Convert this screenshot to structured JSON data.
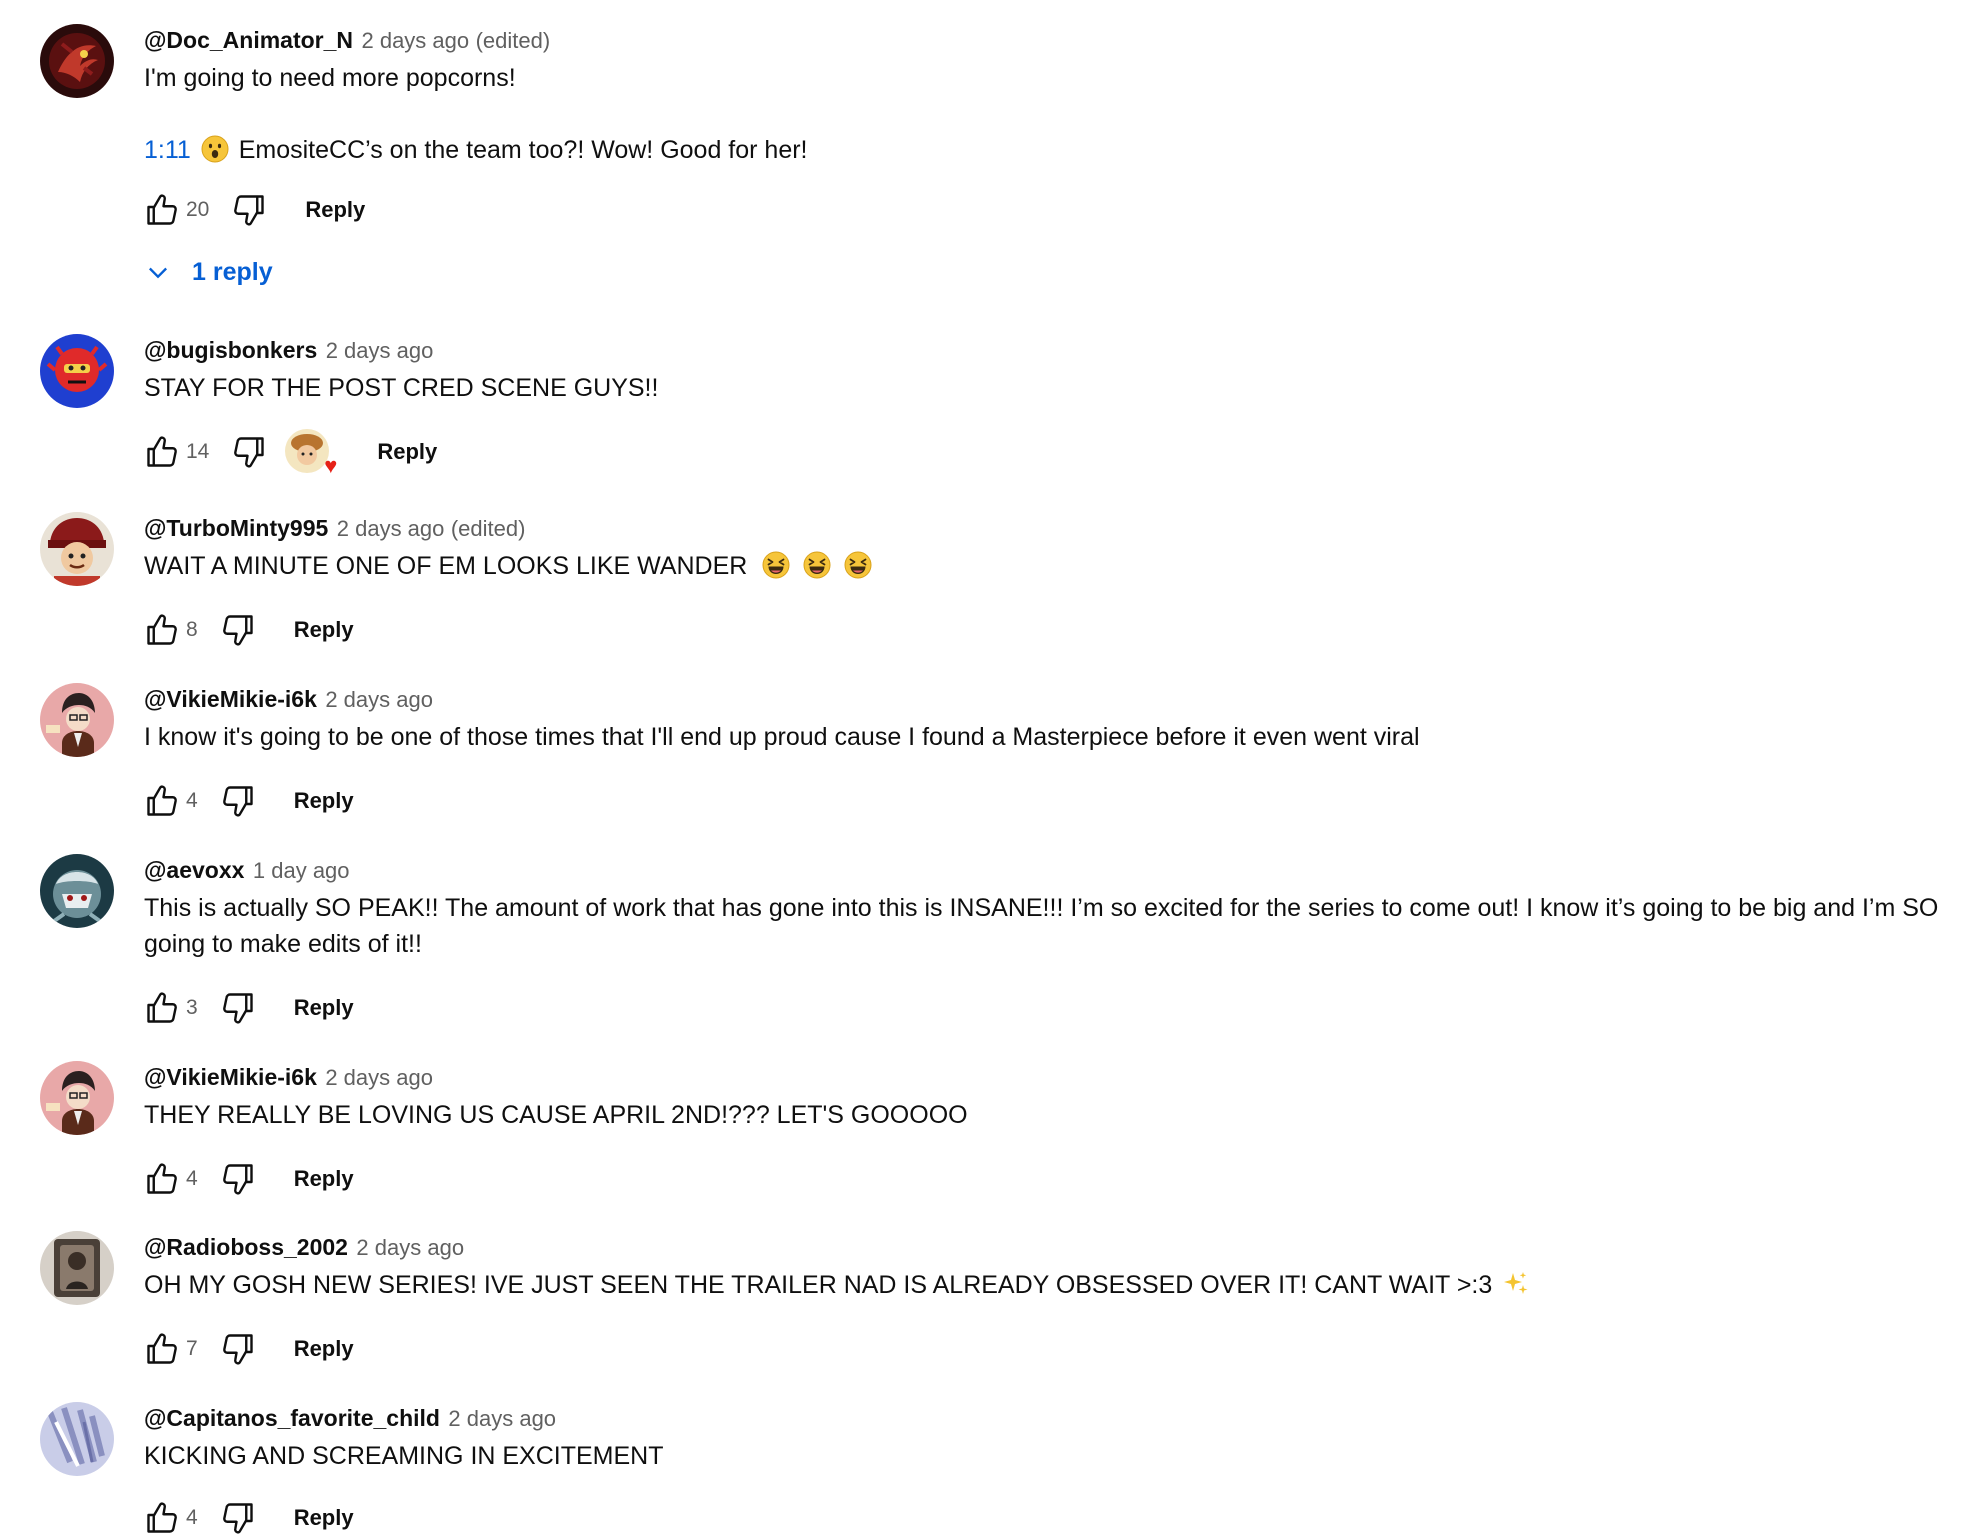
{
  "labels": {
    "reply": "Reply"
  },
  "comments": [
    {
      "author": "@Doc_Animator_N",
      "time": "2 days ago",
      "edited": "(edited)",
      "text_line1": "I'm going to need more popcorns!",
      "timestamp": "1:11",
      "emoji": "astonished-face",
      "text_line2": "EmositeCC’s on the team too?! Wow! Good for her!",
      "likes": "20",
      "replies_label": "1 reply"
    },
    {
      "author": "@bugisbonkers",
      "time": "2 days ago",
      "text": "STAY FOR THE POST CRED SCENE GUYS!!",
      "likes": "14",
      "creator_heart": "♥"
    },
    {
      "author": "@TurboMinty995",
      "time": "2 days ago",
      "edited": "(edited)",
      "text": "WAIT A MINUTE ONE OF EM LOOKS LIKE WANDER",
      "emoji": "grinning-squinting-face",
      "likes": "8"
    },
    {
      "author": "@VikieMikie-i6k",
      "time": "2 days ago",
      "text": "I know it's going to be one of those times that I'll end up proud cause I found a Masterpiece before it even went viral",
      "likes": "4"
    },
    {
      "author": "@aevoxx",
      "time": "1 day ago",
      "text": "This is actually SO PEAK!! The amount of work that has gone into this is INSANE!!! I’m so excited for the series to come out! I know it’s going to be big and I’m SO going to make edits of it!!",
      "likes": "3"
    },
    {
      "author": "@VikieMikie-i6k",
      "time": "2 days ago",
      "text": "THEY REALLY BE LOVING US CAUSE APRIL 2ND!??? LET'S GOOOOO",
      "likes": "4"
    },
    {
      "author": "@Radioboss_2002",
      "time": "2 days ago",
      "text": "OH MY GOSH NEW SERIES! IVE JUST SEEN THE TRAILER NAD IS ALREADY OBSESSED OVER IT! CANT WAIT >:3",
      "emoji": "sparkles",
      "likes": "7"
    },
    {
      "author": "@Capitanos_favorite_child",
      "time": "2 days ago",
      "text": "KICKING AND SCREAMING IN EXCITEMENT",
      "likes": "4"
    }
  ]
}
